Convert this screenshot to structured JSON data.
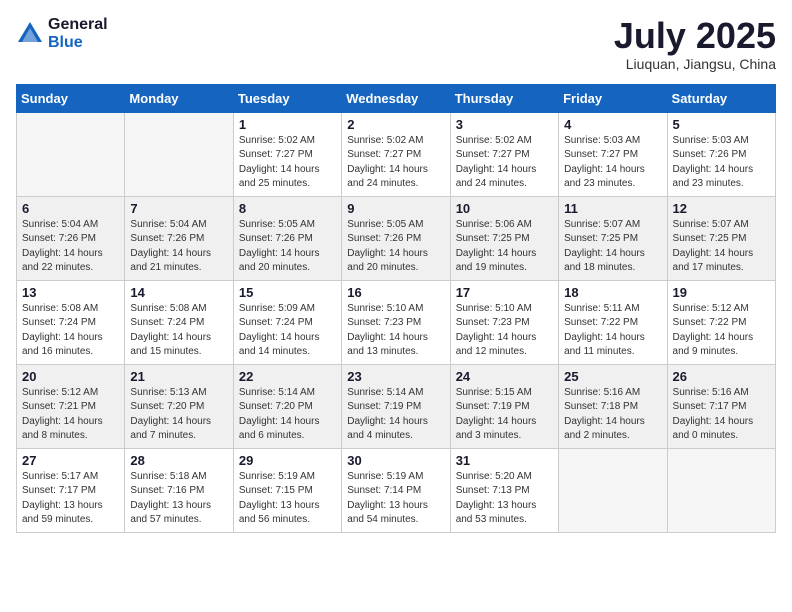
{
  "header": {
    "logo_general": "General",
    "logo_blue": "Blue",
    "month_title": "July 2025",
    "location": "Liuquan, Jiangsu, China"
  },
  "weekdays": [
    "Sunday",
    "Monday",
    "Tuesday",
    "Wednesday",
    "Thursday",
    "Friday",
    "Saturday"
  ],
  "weeks": [
    [
      {
        "day": "",
        "info": ""
      },
      {
        "day": "",
        "info": ""
      },
      {
        "day": "1",
        "info": "Sunrise: 5:02 AM\nSunset: 7:27 PM\nDaylight: 14 hours and 25 minutes."
      },
      {
        "day": "2",
        "info": "Sunrise: 5:02 AM\nSunset: 7:27 PM\nDaylight: 14 hours and 24 minutes."
      },
      {
        "day": "3",
        "info": "Sunrise: 5:02 AM\nSunset: 7:27 PM\nDaylight: 14 hours and 24 minutes."
      },
      {
        "day": "4",
        "info": "Sunrise: 5:03 AM\nSunset: 7:27 PM\nDaylight: 14 hours and 23 minutes."
      },
      {
        "day": "5",
        "info": "Sunrise: 5:03 AM\nSunset: 7:26 PM\nDaylight: 14 hours and 23 minutes."
      }
    ],
    [
      {
        "day": "6",
        "info": "Sunrise: 5:04 AM\nSunset: 7:26 PM\nDaylight: 14 hours and 22 minutes."
      },
      {
        "day": "7",
        "info": "Sunrise: 5:04 AM\nSunset: 7:26 PM\nDaylight: 14 hours and 21 minutes."
      },
      {
        "day": "8",
        "info": "Sunrise: 5:05 AM\nSunset: 7:26 PM\nDaylight: 14 hours and 20 minutes."
      },
      {
        "day": "9",
        "info": "Sunrise: 5:05 AM\nSunset: 7:26 PM\nDaylight: 14 hours and 20 minutes."
      },
      {
        "day": "10",
        "info": "Sunrise: 5:06 AM\nSunset: 7:25 PM\nDaylight: 14 hours and 19 minutes."
      },
      {
        "day": "11",
        "info": "Sunrise: 5:07 AM\nSunset: 7:25 PM\nDaylight: 14 hours and 18 minutes."
      },
      {
        "day": "12",
        "info": "Sunrise: 5:07 AM\nSunset: 7:25 PM\nDaylight: 14 hours and 17 minutes."
      }
    ],
    [
      {
        "day": "13",
        "info": "Sunrise: 5:08 AM\nSunset: 7:24 PM\nDaylight: 14 hours and 16 minutes."
      },
      {
        "day": "14",
        "info": "Sunrise: 5:08 AM\nSunset: 7:24 PM\nDaylight: 14 hours and 15 minutes."
      },
      {
        "day": "15",
        "info": "Sunrise: 5:09 AM\nSunset: 7:24 PM\nDaylight: 14 hours and 14 minutes."
      },
      {
        "day": "16",
        "info": "Sunrise: 5:10 AM\nSunset: 7:23 PM\nDaylight: 14 hours and 13 minutes."
      },
      {
        "day": "17",
        "info": "Sunrise: 5:10 AM\nSunset: 7:23 PM\nDaylight: 14 hours and 12 minutes."
      },
      {
        "day": "18",
        "info": "Sunrise: 5:11 AM\nSunset: 7:22 PM\nDaylight: 14 hours and 11 minutes."
      },
      {
        "day": "19",
        "info": "Sunrise: 5:12 AM\nSunset: 7:22 PM\nDaylight: 14 hours and 9 minutes."
      }
    ],
    [
      {
        "day": "20",
        "info": "Sunrise: 5:12 AM\nSunset: 7:21 PM\nDaylight: 14 hours and 8 minutes."
      },
      {
        "day": "21",
        "info": "Sunrise: 5:13 AM\nSunset: 7:20 PM\nDaylight: 14 hours and 7 minutes."
      },
      {
        "day": "22",
        "info": "Sunrise: 5:14 AM\nSunset: 7:20 PM\nDaylight: 14 hours and 6 minutes."
      },
      {
        "day": "23",
        "info": "Sunrise: 5:14 AM\nSunset: 7:19 PM\nDaylight: 14 hours and 4 minutes."
      },
      {
        "day": "24",
        "info": "Sunrise: 5:15 AM\nSunset: 7:19 PM\nDaylight: 14 hours and 3 minutes."
      },
      {
        "day": "25",
        "info": "Sunrise: 5:16 AM\nSunset: 7:18 PM\nDaylight: 14 hours and 2 minutes."
      },
      {
        "day": "26",
        "info": "Sunrise: 5:16 AM\nSunset: 7:17 PM\nDaylight: 14 hours and 0 minutes."
      }
    ],
    [
      {
        "day": "27",
        "info": "Sunrise: 5:17 AM\nSunset: 7:17 PM\nDaylight: 13 hours and 59 minutes."
      },
      {
        "day": "28",
        "info": "Sunrise: 5:18 AM\nSunset: 7:16 PM\nDaylight: 13 hours and 57 minutes."
      },
      {
        "day": "29",
        "info": "Sunrise: 5:19 AM\nSunset: 7:15 PM\nDaylight: 13 hours and 56 minutes."
      },
      {
        "day": "30",
        "info": "Sunrise: 5:19 AM\nSunset: 7:14 PM\nDaylight: 13 hours and 54 minutes."
      },
      {
        "day": "31",
        "info": "Sunrise: 5:20 AM\nSunset: 7:13 PM\nDaylight: 13 hours and 53 minutes."
      },
      {
        "day": "",
        "info": ""
      },
      {
        "day": "",
        "info": ""
      }
    ]
  ]
}
